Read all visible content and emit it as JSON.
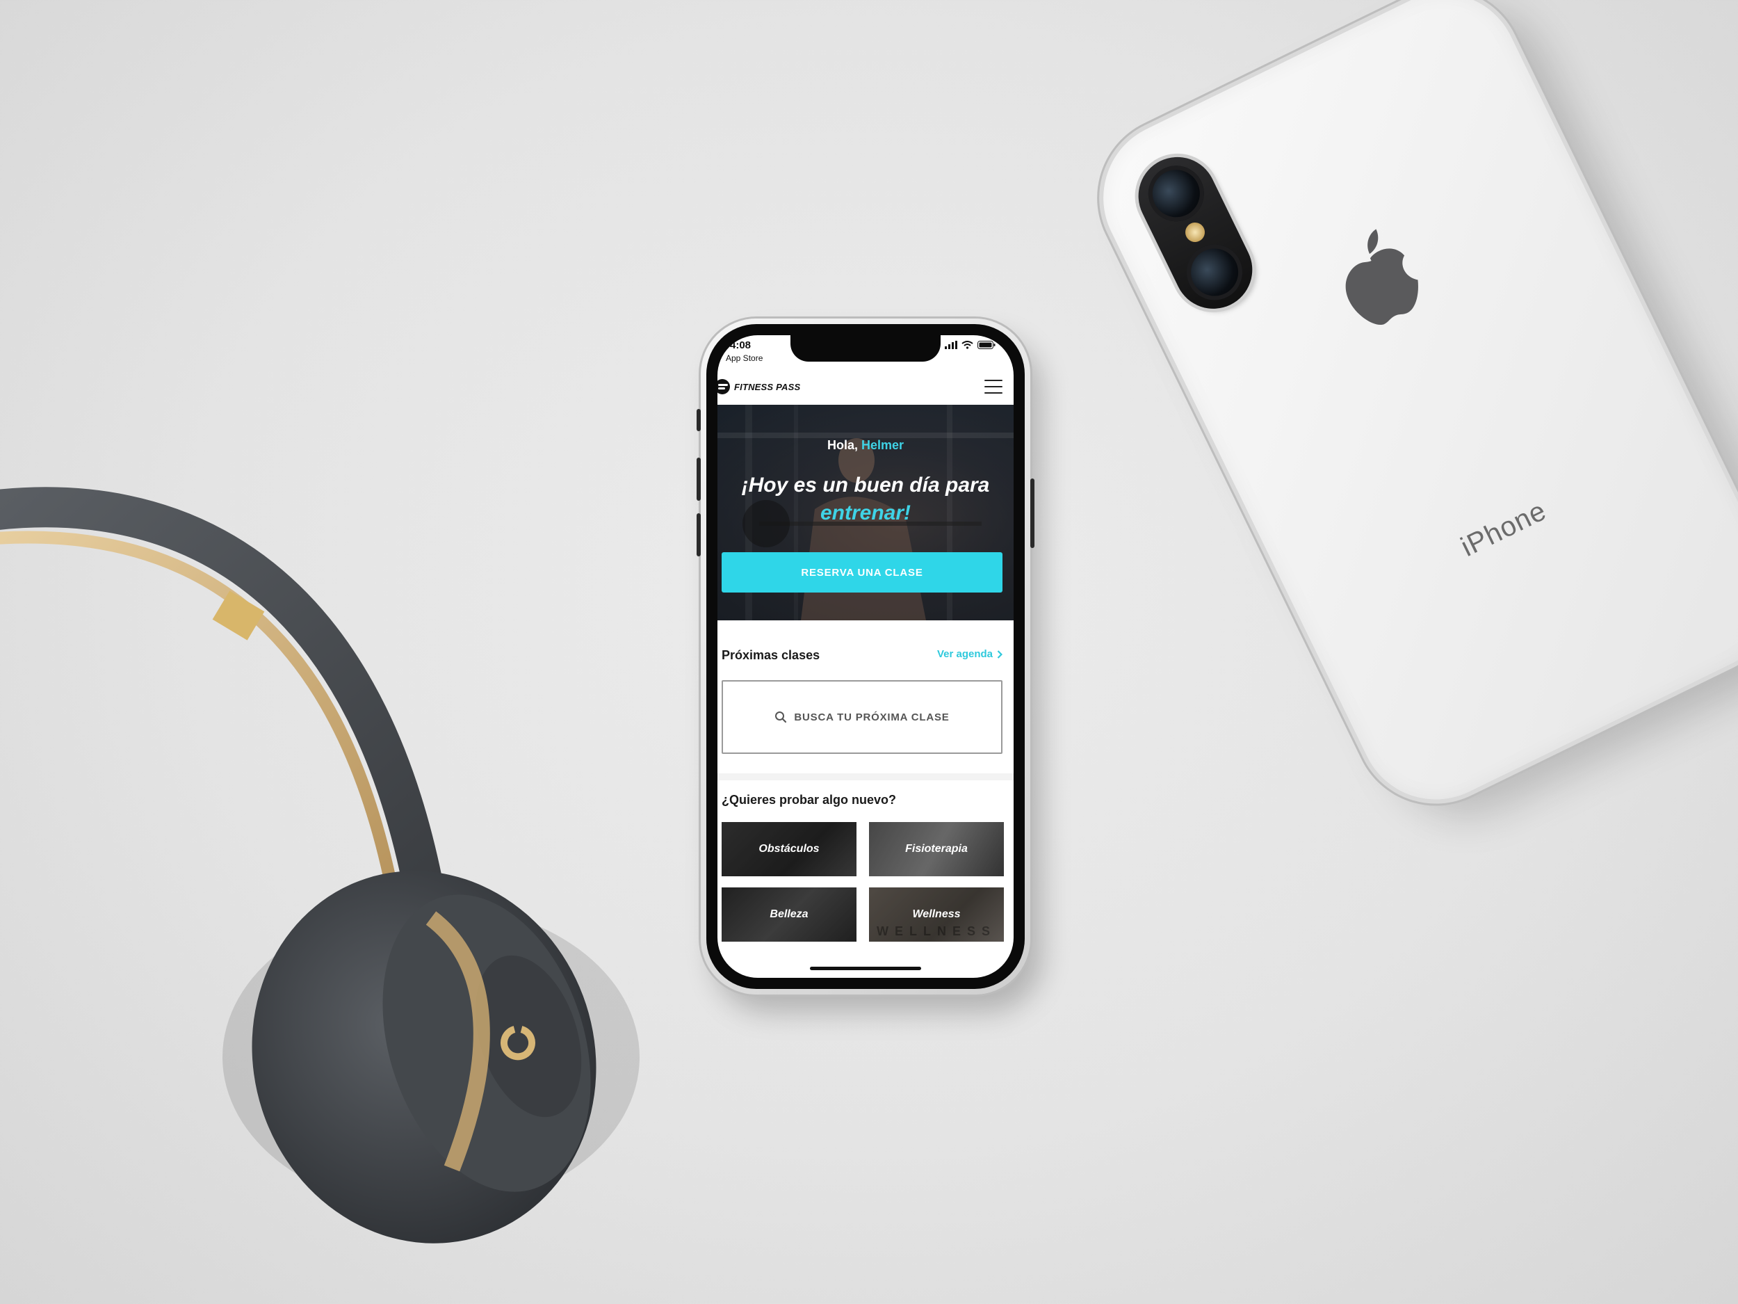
{
  "app": {
    "name": "FITNESS PASS"
  },
  "status_bar": {
    "time": "4:08",
    "back_label": "App Store"
  },
  "hero": {
    "greeting_prefix": "Hola,",
    "user_name": "Helmer",
    "title_line1": "¡Hoy es un buen día para",
    "title_accent": "entrenar!",
    "cta_label": "RESERVA UNA CLASE"
  },
  "upcoming": {
    "title": "Próximas clases",
    "agenda_link": "Ver agenda",
    "search_placeholder": "BUSCA TU PRÓXIMA CLASE"
  },
  "discover": {
    "title": "¿Quieres probar algo nuevo?",
    "categories": [
      {
        "label": "Obstáculos"
      },
      {
        "label": "Fisioterapia"
      },
      {
        "label": "Belleza"
      },
      {
        "label": "Wellness",
        "watermark": "WELLNESS"
      }
    ]
  },
  "back_device": {
    "label": "iPhone"
  },
  "colors": {
    "accent": "#2fd6e8",
    "link": "#2fc9dc",
    "text": "#1a1a1a"
  }
}
